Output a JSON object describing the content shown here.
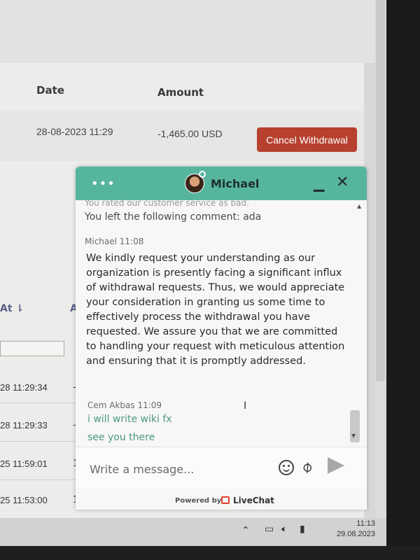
{
  "table": {
    "headers": {
      "date": "Date",
      "amount": "Amount"
    },
    "row": {
      "date": "28-08-2023 11:29",
      "amount": "-1,465.00 USD",
      "action": "Cancel Withdrawal"
    },
    "filter": {
      "column_label": "At ⇂",
      "second_label": "A"
    },
    "rows": [
      {
        "time": "28 11:29:34",
        "side": "-"
      },
      {
        "time": "28 11:29:33",
        "side": "-"
      },
      {
        "time": "25 11:59:01",
        "side": "1"
      },
      {
        "time": "25 11:53:00",
        "side": "1"
      }
    ]
  },
  "chat": {
    "agent_name": "Michael",
    "status_color": "#56b59d",
    "faded_text": "You rated our customer service as bad.",
    "comment": "You left the following comment: ada",
    "agent_meta": "Michael 11:08",
    "agent_message": "We kindly request your understanding as our organization is presently facing a significant influx of withdrawal requests. Thus, we would appreciate your consideration in granting us some time to effectively process the withdrawal you have requested. We assure you that we are committed to handling your request with meticulous attention and ensuring that it is promptly addressed.",
    "user_meta": "Cem Akbas 11:09",
    "user_messages": [
      "i will write wiki fx",
      "see you there"
    ],
    "composer_placeholder": "Write a message...",
    "powered_by": "Powered by",
    "brand": "LiveChat",
    "icons": [
      "emoji-icon",
      "attach-icon",
      "send-icon",
      "minimize-icon",
      "close-icon",
      "menu-icon"
    ]
  },
  "taskbar": {
    "time": "11:13",
    "date": "29.08.2023",
    "icons": [
      "chevron-up-icon",
      "network-icon",
      "volume-icon",
      "battery-icon"
    ]
  },
  "colors": {
    "header_green": "#56b59d",
    "cancel_red": "#b7402f",
    "livechat_red": "#e0402e"
  }
}
